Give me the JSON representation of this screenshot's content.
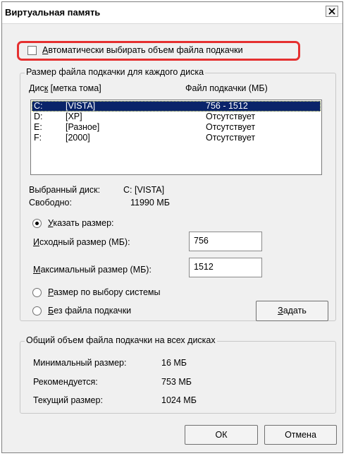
{
  "window": {
    "title": "Виртуальная память"
  },
  "auto_manage": {
    "label": "Автоматически выбирать объем файла подкачки",
    "checked": false,
    "highlight_color": "#e53030"
  },
  "drives_group": {
    "legend": "Размер файла подкачки для каждого диска",
    "columns": [
      "Диск [метка тома]",
      "Файл подкачки (МБ)"
    ],
    "rows": [
      {
        "drive": "C:",
        "label": "[VISTA]",
        "pagefile": "756 - 1512",
        "selected": true
      },
      {
        "drive": "D:",
        "label": "[XP]",
        "pagefile": "Отсутствует",
        "selected": false
      },
      {
        "drive": "E:",
        "label": "[Разное]",
        "pagefile": "Отсутствует",
        "selected": false
      },
      {
        "drive": "F:",
        "label": "[2000]",
        "pagefile": "Отсутствует",
        "selected": false
      }
    ],
    "selection_color": "#0a246a",
    "selected_drive_label": "Выбранный диск:",
    "selected_drive_value": "C:  [VISTA]",
    "free_label": "Свободно:",
    "free_value": "11990 МБ",
    "custom_size": {
      "label": "Указать размер:",
      "checked": true
    },
    "initial_size": {
      "label": "Исходный размер (МБ):",
      "value": "756"
    },
    "max_size": {
      "label": "Максимальный размер (МБ):",
      "value": "1512"
    },
    "system_managed": {
      "label": "Размер по выбору системы",
      "checked": false
    },
    "no_paging": {
      "label": "Без файла подкачки",
      "checked": false
    },
    "set_button": "Задать"
  },
  "totals_group": {
    "legend": "Общий объем файла подкачки на всех дисках",
    "rows": [
      {
        "label": "Минимальный размер:",
        "value": "16 МБ"
      },
      {
        "label": "Рекомендуется:",
        "value": "753 МБ"
      },
      {
        "label": "Текущий размер:",
        "value": "1024 МБ"
      }
    ]
  },
  "buttons": {
    "ok": "ОК",
    "cancel": "Отмена"
  }
}
